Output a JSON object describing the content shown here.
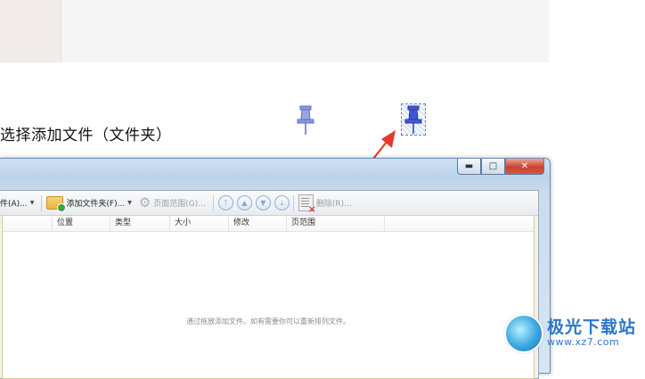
{
  "instruction": "选择添加文件（文件夹）",
  "window": {
    "controls": {
      "minimize": "▬",
      "maximize": "□",
      "close": "✕"
    },
    "toolbar": {
      "add_file_label": "件(A)...",
      "add_folder_label": "添加文件夹(F)...",
      "page_range_label": "页面范围(G)...",
      "delete_label": "删除(R)..."
    },
    "columns": [
      "",
      "位置",
      "类型",
      "大小",
      "修改",
      "页范围"
    ],
    "empty_hint": "通过拖放添加文件。如有需要你可以重新排列文件。"
  },
  "watermark": {
    "title": "极光下载站",
    "url": "www.xz7.com"
  },
  "colors": {
    "arrow": "#e23b2e",
    "pin": "#6e7fd6",
    "accent": "#2c77c8"
  }
}
